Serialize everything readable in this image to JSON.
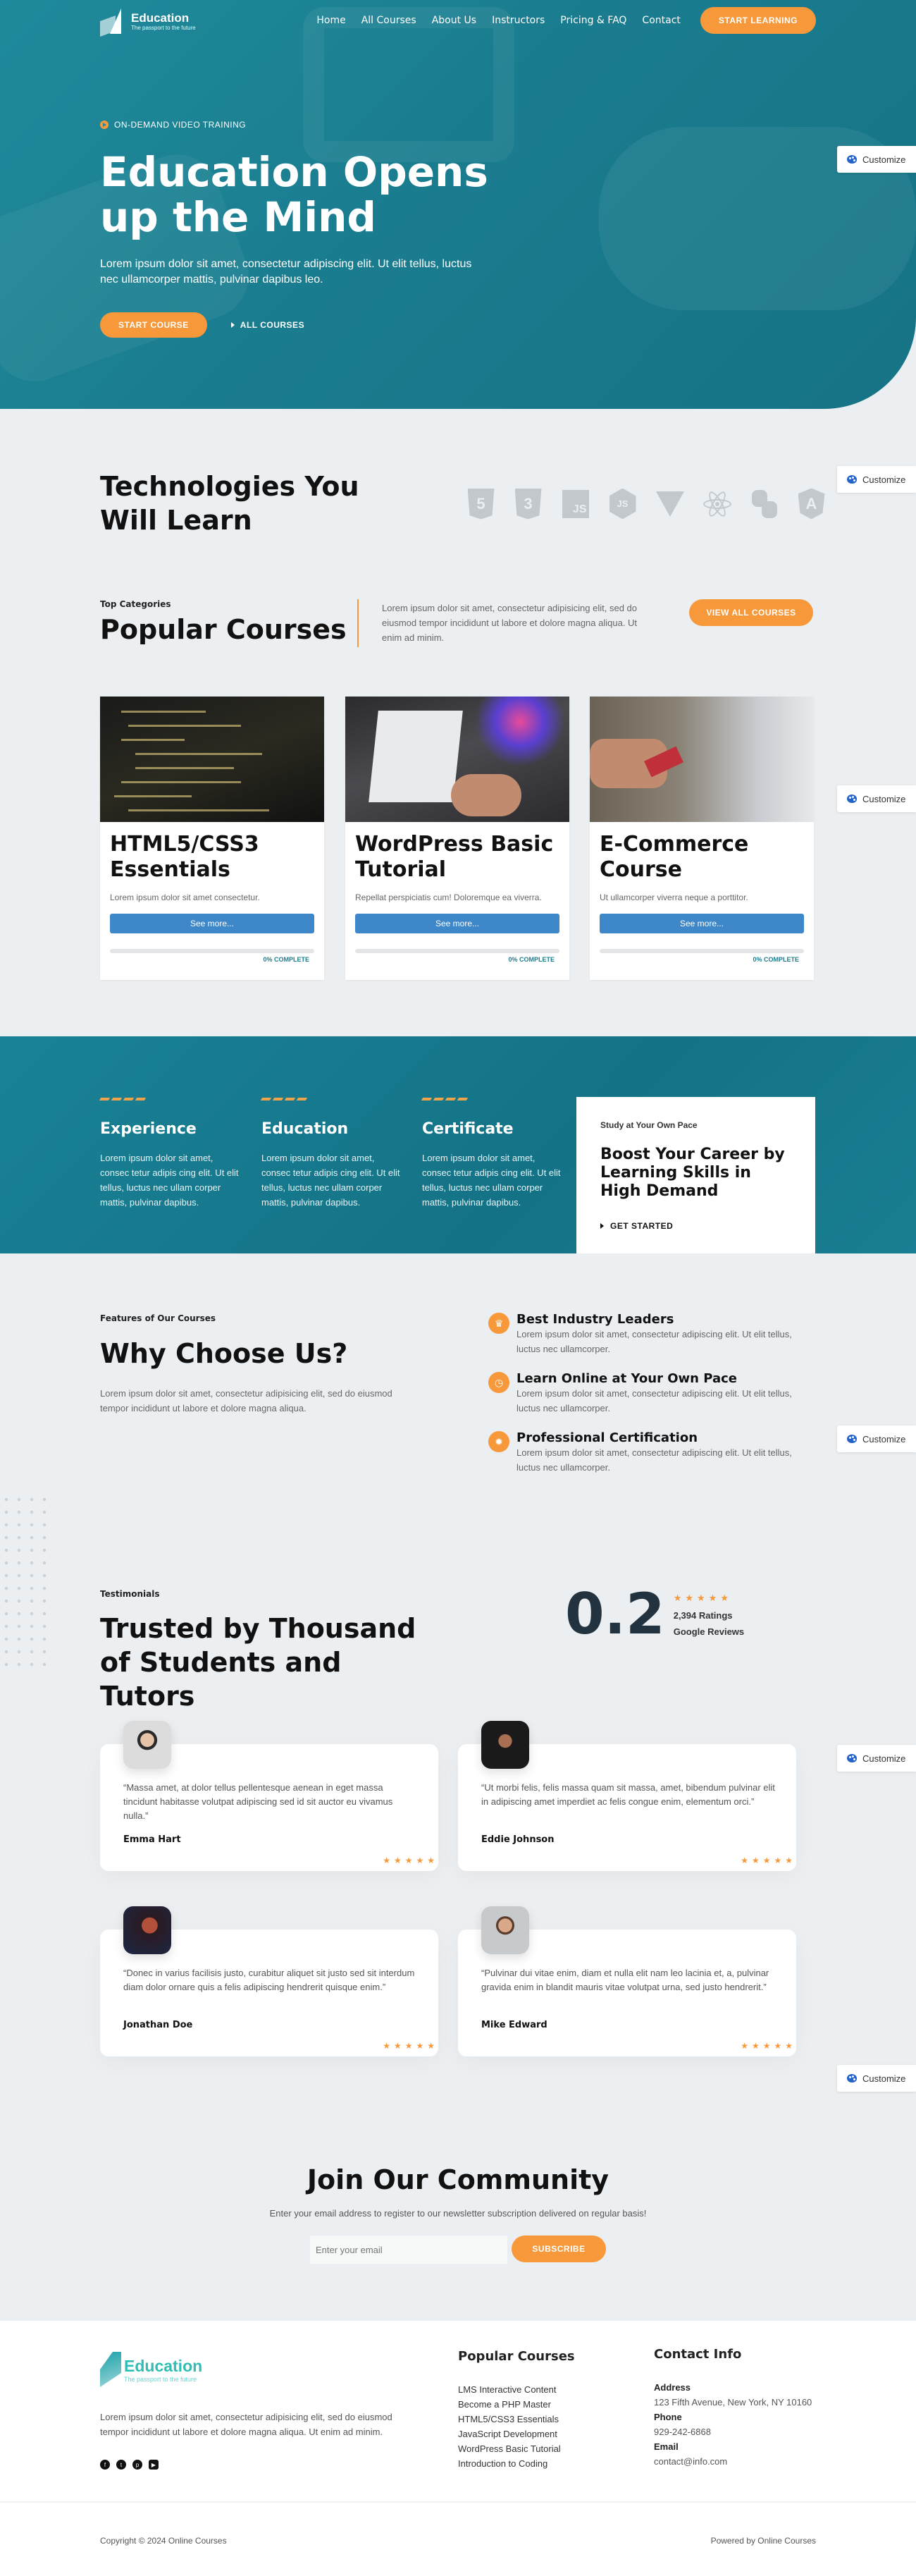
{
  "header": {
    "logo_title": "Education",
    "logo_tagline": "The passport to the future",
    "nav": [
      "Home",
      "All Courses",
      "About Us",
      "Instructors",
      "Pricing & FAQ",
      "Contact"
    ],
    "cta": "START LEARNING"
  },
  "hero": {
    "kicker": "ON-DEMAND VIDEO TRAINING",
    "title": "Education Opens up the Mind",
    "subtitle": "Lorem ipsum dolor sit amet, consectetur adipiscing elit. Ut elit tellus, luctus nec ullamcorper mattis, pulvinar dapibus leo.",
    "primary_button": "START COURSE",
    "secondary_link": "ALL COURSES"
  },
  "customize_label": "Customize",
  "technologies": {
    "title": "Technologies You Will Learn",
    "icons": [
      "html5-icon",
      "css3-icon",
      "javascript-icon",
      "nodejs-icon",
      "vue-icon",
      "react-icon",
      "python-icon",
      "angular-icon"
    ],
    "labels": [
      "5",
      "3",
      "JS",
      "JS"
    ]
  },
  "popular": {
    "kicker": "Top Categories",
    "title": "Popular Courses",
    "text": "Lorem ipsum dolor sit amet, consectetur adipisicing elit, sed do eiusmod tempor incididunt ut labore et dolore magna aliqua. Ut enim ad minim.",
    "button": "VIEW ALL COURSES",
    "courses": [
      {
        "title": "HTML5/CSS3 Essentials",
        "desc": "Lorem ipsum dolor sit amet consectetur.",
        "button": "See more...",
        "progress_percent": 0,
        "progress_label": "0% COMPLETE"
      },
      {
        "title": "WordPress Basic Tutorial",
        "desc": "Repellat perspiciatis cum! Doloremque ea viverra.",
        "button": "See more...",
        "progress_percent": 0,
        "progress_label": "0% COMPLETE"
      },
      {
        "title": "E-Commerce Course",
        "desc": "Ut ullamcorper viverra neque a porttitor.",
        "button": "See more...",
        "progress_percent": 0,
        "progress_label": "0% COMPLETE"
      }
    ]
  },
  "features": {
    "items": [
      {
        "title": "Experience",
        "text": "Lorem ipsum dolor sit amet, consec tetur adipis cing elit. Ut elit tellus, luctus nec ullam corper mattis, pulvinar dapibus."
      },
      {
        "title": "Education",
        "text": "Lorem ipsum dolor sit amet, consec tetur adipis cing elit. Ut elit tellus, luctus nec ullam corper mattis, pulvinar dapibus."
      },
      {
        "title": "Certificate",
        "text": "Lorem ipsum dolor sit amet, consec tetur adipis cing elit. Ut elit tellus, luctus nec ullam corper mattis, pulvinar dapibus."
      }
    ],
    "boost": {
      "kicker": "Study at Your Own Pace",
      "title": "Boost Your Career by Learning Skills in High Demand",
      "link": "GET STARTED"
    }
  },
  "why": {
    "kicker": "Features of Our Courses",
    "title": "Why Choose Us?",
    "text": "Lorem ipsum dolor sit amet, consectetur adipisicing elit, sed do eiusmod tempor incididunt ut labore et dolore magna aliqua.",
    "items": [
      {
        "icon": "crown-icon",
        "glyph": "♛",
        "title": "Best Industry Leaders",
        "text": "Lorem ipsum dolor sit amet, consectetur adipiscing elit. Ut elit tellus, luctus nec ullamcorper."
      },
      {
        "icon": "clock-icon",
        "glyph": "◷",
        "title": "Learn Online at Your Own Pace",
        "text": "Lorem ipsum dolor sit amet, consectetur adipiscing elit. Ut elit tellus, luctus nec ullamcorper."
      },
      {
        "icon": "certificate-icon",
        "glyph": "✹",
        "title": "Professional Certification",
        "text": "Lorem ipsum dolor sit amet, consectetur adipiscing elit. Ut elit tellus, luctus nec ullamcorper."
      }
    ]
  },
  "testimonials": {
    "kicker": "Testimonials",
    "title": "Trusted by Thousand of Students and Tutors",
    "score": "0.2",
    "stars": "★★★★★",
    "ratings_count": "2,394 Ratings",
    "ratings_source": "Google Reviews",
    "items": [
      {
        "quote": "“Massa amet, at dolor tellus pellentesque aenean in eget massa tincidunt habitasse volutpat adipiscing sed id sit auctor eu vivamus nulla.”",
        "name": "Emma Hart",
        "stars": "★★★★★"
      },
      {
        "quote": "“Ut morbi felis, felis massa quam sit massa, amet, bibendum pulvinar elit in adipiscing amet imperdiet ac felis congue enim, elementum orci.”",
        "name": "Eddie Johnson",
        "stars": "★★★★★"
      },
      {
        "quote": "“Donec in varius facilisis justo, curabitur aliquet sit justo sed sit interdum diam dolor ornare quis a felis adipiscing hendrerit quisque enim.”",
        "name": "Jonathan Doe",
        "stars": "★★★★★"
      },
      {
        "quote": "“Pulvinar dui vitae enim, diam et nulla elit nam leo lacinia et, a, pulvinar gravida enim in blandit mauris vitae volutpat urna, sed justo hendrerit.”",
        "name": "Mike Edward",
        "stars": "★★★★★"
      }
    ]
  },
  "newsletter": {
    "title": "Join Our Community",
    "text": "Enter your email address to register to our newsletter subscription delivered on regular basis!",
    "placeholder": "Enter your email",
    "button": "SUBSCRIBE"
  },
  "footer": {
    "logo_title": "Education",
    "logo_tagline": "The passport to the future",
    "about": "Lorem ipsum dolor sit amet, consectetur adipisicing elit, sed do eiusmod tempor incididunt ut labore et dolore magna aliqua. Ut enim ad minim.",
    "socials": [
      "facebook-icon",
      "twitter-icon",
      "pinterest-icon",
      "youtube-icon"
    ],
    "courses_title": "Popular Courses",
    "courses": [
      "LMS Interactive Content",
      "Become a PHP Master",
      "HTML5/CSS3 Essentials",
      "JavaScript Development",
      "WordPress Basic Tutorial",
      "Introduction to Coding"
    ],
    "contact_title": "Contact Info",
    "address_label": "Address",
    "address": "123 Fifth Avenue, New York, NY 10160",
    "phone_label": "Phone",
    "phone": "929-242-6868",
    "email_label": "Email",
    "email": "contact@info.com",
    "copyright": "Copyright © 2024 Online Courses",
    "powered": "Powered by Online Courses"
  },
  "colors": {
    "teal": "#1f8a9b",
    "orange": "#f7983a",
    "button_blue": "#3e87c8"
  }
}
